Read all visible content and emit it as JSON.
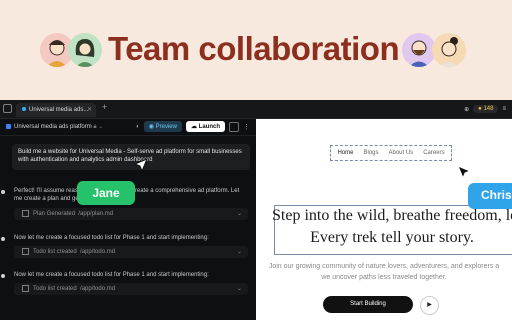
{
  "hero": {
    "title": "Team collaboration"
  },
  "browser": {
    "tab_title": "Universal media ads...",
    "credits": "148"
  },
  "toolbar": {
    "project_name": "Universal media ads platform",
    "preview_label": "Preview",
    "launch_label": "Launch"
  },
  "chat": {
    "prompt": "Build me a website for Universal Media - Self-serve ad platform for small businesses with authentication and analytics admin dashboard",
    "msg1": "Perfect! I'll assume reasonable defaults and create a comprehensive ad platform. Let me create a plan and get started:",
    "file1_label": "Plan Generated",
    "file1_path": "/app/plan.md",
    "msg2": "Now let me create a focused todo list for Phase 1 and start implementing:",
    "file2_label": "Todo list created",
    "file2_path": "/app/todo.md",
    "msg3": "Now let me create a focused todo list for Phase 1 and start implementing:",
    "file3_label": "Todo list created",
    "file3_path": "/app/todo.md"
  },
  "collaborators": {
    "left": "Jane",
    "right": "Chris"
  },
  "preview": {
    "nav": [
      "Home",
      "Blogs",
      "About Us",
      "Careers"
    ],
    "headline_line1": "Step into the wild, breathe freedom, let",
    "headline_line2": "Every trek tell your story.",
    "subtext_line1": "Join our growing community of nature lovers, adventurers, and explorers a",
    "subtext_line2": "we uncover paths less traveled together.",
    "cta_label": "Start Building"
  },
  "colors": {
    "accent": "#8c2f1e",
    "tag": "#25c16b",
    "tag_chris": "#2fa4e8"
  }
}
